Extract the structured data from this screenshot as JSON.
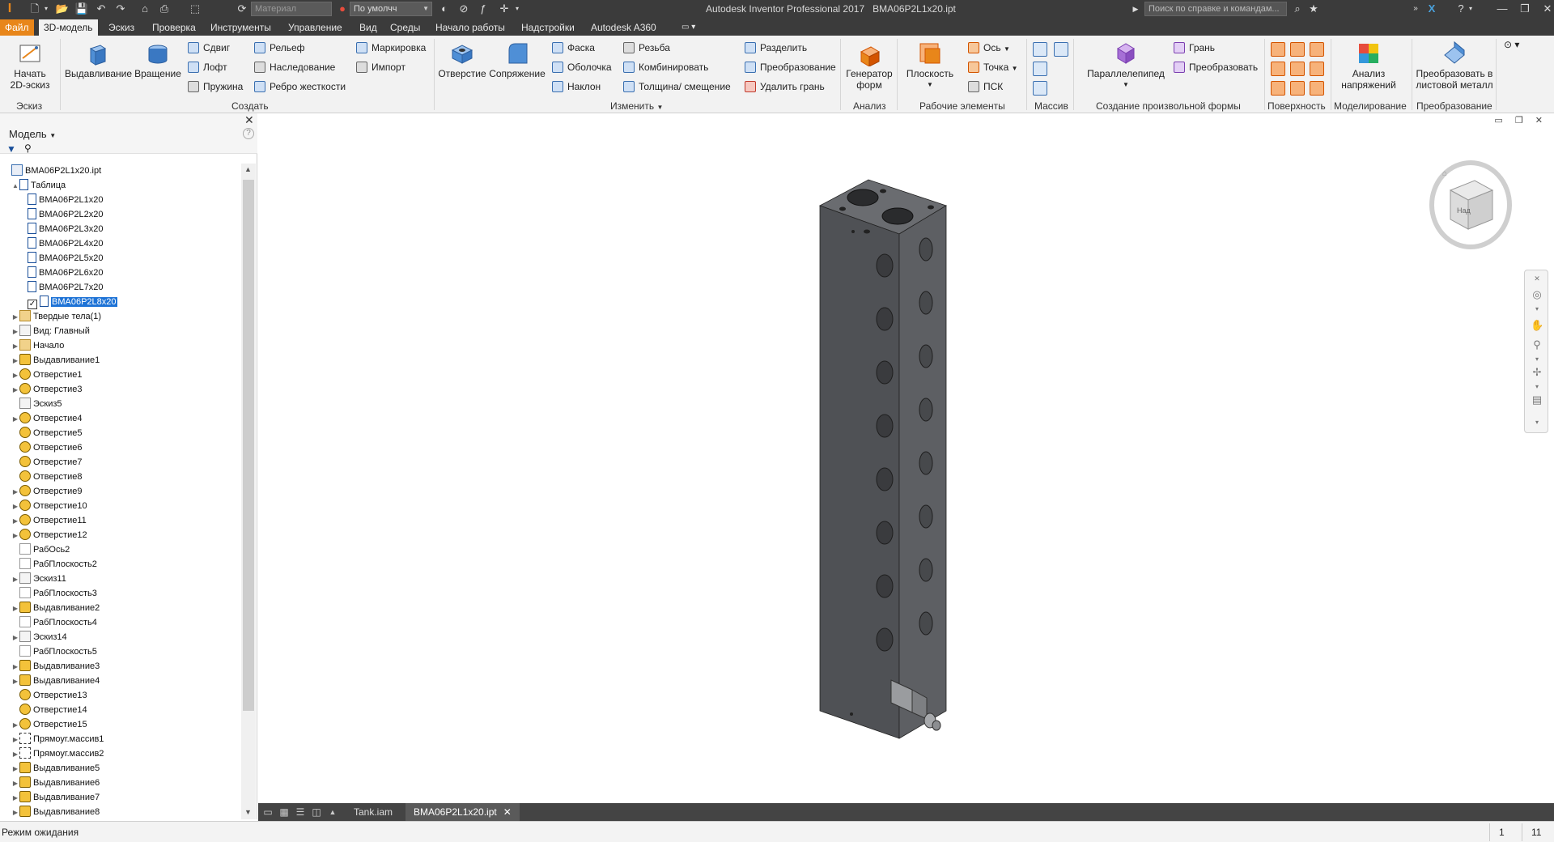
{
  "app": {
    "title": "Autodesk Inventor Professional 2017",
    "document": "BMA06P2L1x20.ipt",
    "logo_letter": "I",
    "search_placeholder": "Поиск по справке и командам...",
    "material_placeholder": "Материал",
    "appearance_value": "По умолчч"
  },
  "menu": {
    "file": "Файл",
    "tabs": [
      "3D-модель",
      "Эскиз",
      "Проверка",
      "Инструменты",
      "Управление",
      "Вид",
      "Среды",
      "Начало работы",
      "Надстройки",
      "Autodesk A360"
    ],
    "active_tab": "3D-модель"
  },
  "ribbon": {
    "sketch": {
      "start_label": "Начать\n2D-эскиз",
      "panel": "Эскиз"
    },
    "create": {
      "extrude": "Выдавливание",
      "revolve": "Вращение",
      "sweep": "Сдвиг",
      "loft": "Лофт",
      "coil": "Пружина",
      "emboss": "Рельеф",
      "derive": "Наследование",
      "rib": "Ребро жесткости",
      "mark": "Маркировка",
      "import": "Импорт",
      "panel": "Создать"
    },
    "modify": {
      "hole": "Отверстие",
      "fillet": "Сопряжение",
      "chamfer": "Фаска",
      "shell": "Оболочка",
      "draft": "Наклон",
      "thread": "Резьба",
      "combine": "Комбинировать",
      "thicken": "Толщина/ смещение",
      "split": "Разделить",
      "direct": "Преобразование",
      "delete_face": "Удалить грань",
      "panel": "Изменить"
    },
    "explore": {
      "shape_gen": "Генератор\nформ",
      "panel": "Анализ"
    },
    "work_features": {
      "plane": "Плоскость",
      "axis": "Ось",
      "point": "Точка",
      "ucs": "ПСК",
      "panel": "Рабочие элементы"
    },
    "pattern": {
      "panel": "Массив"
    },
    "freeform": {
      "box": "Параллелепипед",
      "face": "Грань",
      "convert": "Преобразовать",
      "panel": "Создание произвольной формы"
    },
    "surface": {
      "panel": "Поверхность"
    },
    "simulation": {
      "stress": "Анализ\nнапряжений",
      "panel": "Моделирование"
    },
    "convert": {
      "sheet_metal": "Преобразовать в\nлистовой металл",
      "panel": "Преобразование"
    }
  },
  "browser": {
    "title": "Модель",
    "nodes": [
      {
        "label": "BMA06P2L1x20.ipt",
        "icon": "part",
        "level": 0,
        "expand": ""
      },
      {
        "label": "Таблица",
        "icon": "cfg",
        "level": 1,
        "expand": "▲"
      },
      {
        "label": "BMA06P2L1x20",
        "icon": "cfg",
        "level": 2,
        "expand": ""
      },
      {
        "label": "BMA06P2L2x20",
        "icon": "cfg",
        "level": 2,
        "expand": ""
      },
      {
        "label": "BMA06P2L3x20",
        "icon": "cfg",
        "level": 2,
        "expand": ""
      },
      {
        "label": "BMA06P2L4x20",
        "icon": "cfg",
        "level": 2,
        "expand": ""
      },
      {
        "label": "BMA06P2L5x20",
        "icon": "cfg",
        "level": 2,
        "expand": ""
      },
      {
        "label": "BMA06P2L6x20",
        "icon": "cfg",
        "level": 2,
        "expand": ""
      },
      {
        "label": "BMA06P2L7x20",
        "icon": "cfg",
        "level": 2,
        "expand": ""
      },
      {
        "label": "BMA06P2L8x20",
        "icon": "cfg",
        "level": 2,
        "expand": "",
        "checked": true,
        "selected": true
      },
      {
        "label": "Твердые тела(1)",
        "icon": "folder",
        "level": 1,
        "expand": "▶"
      },
      {
        "label": "Вид: Главный",
        "icon": "sketch",
        "level": 1,
        "expand": "▶"
      },
      {
        "label": "Начало",
        "icon": "folder",
        "level": 1,
        "expand": "▶"
      },
      {
        "label": "Выдавливание1",
        "icon": "feat",
        "level": 1,
        "expand": "▶"
      },
      {
        "label": "Отверстие1",
        "icon": "hole",
        "level": 1,
        "expand": "▶"
      },
      {
        "label": "Отверстие3",
        "icon": "hole",
        "level": 1,
        "expand": "▶"
      },
      {
        "label": "Эскиз5",
        "icon": "sketch",
        "level": 1,
        "expand": ""
      },
      {
        "label": "Отверстие4",
        "icon": "hole",
        "level": 1,
        "expand": "▶"
      },
      {
        "label": "Отверстие5",
        "icon": "hole",
        "level": 1,
        "expand": ""
      },
      {
        "label": "Отверстие6",
        "icon": "hole",
        "level": 1,
        "expand": ""
      },
      {
        "label": "Отверстие7",
        "icon": "hole",
        "level": 1,
        "expand": ""
      },
      {
        "label": "Отверстие8",
        "icon": "hole",
        "level": 1,
        "expand": ""
      },
      {
        "label": "Отверстие9",
        "icon": "hole",
        "level": 1,
        "expand": "▶"
      },
      {
        "label": "Отверстие10",
        "icon": "hole",
        "level": 1,
        "expand": "▶"
      },
      {
        "label": "Отверстие11",
        "icon": "hole",
        "level": 1,
        "expand": "▶"
      },
      {
        "label": "Отверстие12",
        "icon": "hole",
        "level": 1,
        "expand": "▶"
      },
      {
        "label": "РабОсь2",
        "icon": "plane",
        "level": 1,
        "expand": ""
      },
      {
        "label": "РабПлоскость2",
        "icon": "plane",
        "level": 1,
        "expand": ""
      },
      {
        "label": "Эскиз11",
        "icon": "sketch",
        "level": 1,
        "expand": "▶"
      },
      {
        "label": "РабПлоскость3",
        "icon": "plane",
        "level": 1,
        "expand": ""
      },
      {
        "label": "Выдавливание2",
        "icon": "feat",
        "level": 1,
        "expand": "▶"
      },
      {
        "label": "РабПлоскость4",
        "icon": "plane",
        "level": 1,
        "expand": ""
      },
      {
        "label": "Эскиз14",
        "icon": "sketch",
        "level": 1,
        "expand": "▶"
      },
      {
        "label": "РабПлоскость5",
        "icon": "plane",
        "level": 1,
        "expand": ""
      },
      {
        "label": "Выдавливание3",
        "icon": "feat",
        "level": 1,
        "expand": "▶"
      },
      {
        "label": "Выдавливание4",
        "icon": "feat",
        "level": 1,
        "expand": "▶"
      },
      {
        "label": "Отверстие13",
        "icon": "hole",
        "level": 1,
        "expand": ""
      },
      {
        "label": "Отверстие14",
        "icon": "hole",
        "level": 1,
        "expand": ""
      },
      {
        "label": "Отверстие15",
        "icon": "hole",
        "level": 1,
        "expand": "▶"
      },
      {
        "label": "Прямоуг.массив1",
        "icon": "pattern",
        "level": 1,
        "expand": "▶"
      },
      {
        "label": "Прямоуг.массив2",
        "icon": "pattern",
        "level": 1,
        "expand": "▶"
      },
      {
        "label": "Выдавливание5",
        "icon": "feat",
        "level": 1,
        "expand": "▶"
      },
      {
        "label": "Выдавливание6",
        "icon": "feat",
        "level": 1,
        "expand": "▶"
      },
      {
        "label": "Выдавливание7",
        "icon": "feat",
        "level": 1,
        "expand": "▶"
      },
      {
        "label": "Выдавливание8",
        "icon": "feat",
        "level": 1,
        "expand": "▶"
      }
    ]
  },
  "viewcube": {
    "face_label": "Над"
  },
  "doc_tabs": [
    "Tank.iam",
    "BMA06P2L1x20.ipt"
  ],
  "active_doc": "BMA06P2L1x20.ipt",
  "status": {
    "text": "Режим ожидания",
    "num1": "1",
    "num2": "11"
  },
  "colors": {
    "accent": "#e8861a",
    "selection": "#1e73d6",
    "part_face": "#56585c"
  }
}
